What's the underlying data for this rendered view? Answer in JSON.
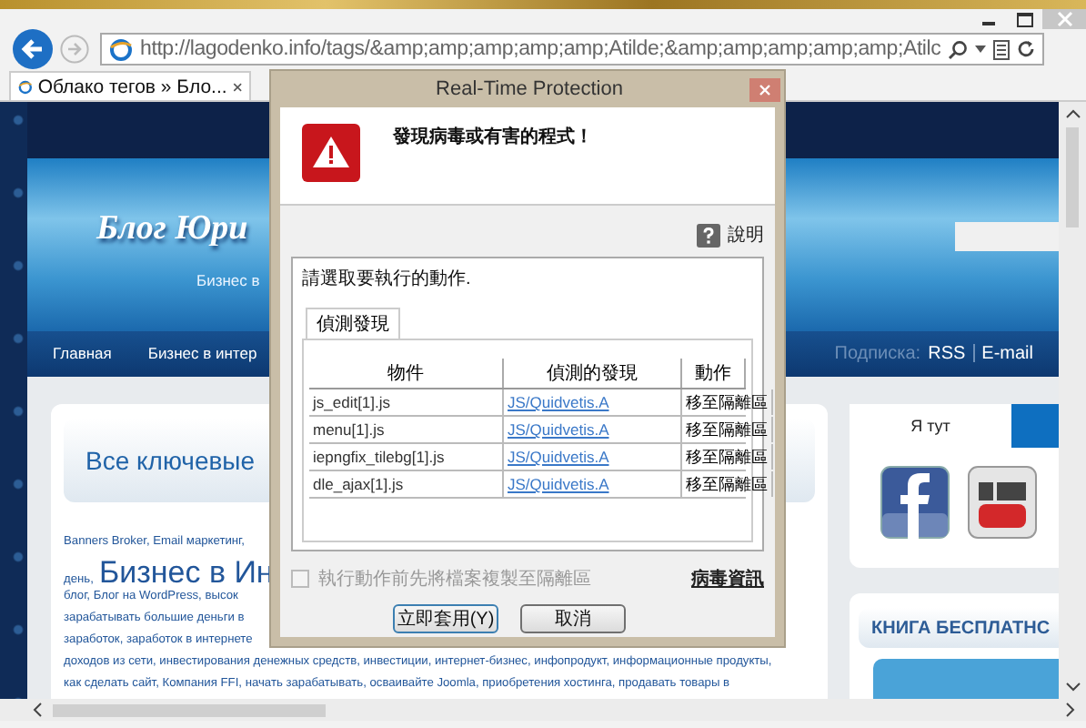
{
  "browser": {
    "address": "http://lagodenko.info/tags/&amp;amp;amp;amp;amp;Atilde;&amp;amp;amp;amp;amp;Atilc",
    "tab": {
      "title": "Облако тегов » Бло...",
      "selected": true
    }
  },
  "page": {
    "site_title": "Блог Юри",
    "tagline": "Бизнес в",
    "nav": [
      "Главная",
      "Бизнес в интер"
    ],
    "subscribe": {
      "label": "Подписка:",
      "links": [
        "RSS",
        "E-mail"
      ]
    },
    "heading": "Все ключевые",
    "tag_lines": [
      {
        "parts": [
          {
            "text": "Banners Broker, Email маркетинг,",
            "kind": "small"
          }
        ]
      },
      {
        "parts": [
          {
            "text": "день,",
            "kind": "small"
          },
          {
            "text": "Бизнес в Ин",
            "kind": "large"
          }
        ]
      },
      {
        "parts": [
          {
            "text": "блог, Блог на WordPress, высок",
            "kind": "small"
          }
        ]
      },
      {
        "parts": [
          {
            "text": "зарабатывать большие деньги в",
            "kind": "small"
          }
        ]
      },
      {
        "parts": [
          {
            "text": "заработок, заработок в интернете",
            "kind": "small"
          }
        ]
      },
      {
        "parts": [
          {
            "text": "доходов из сети, инвестирования денежных средств, инвестиции, интернет-бизнес, инфопродукт, информационные продукты,",
            "kind": "small"
          }
        ]
      },
      {
        "parts": [
          {
            "text": "как сделать сайт, Компания FFI, начать зарабатывать, осваивайте Joomla, приобретения хостинга, продавать товары в",
            "kind": "small"
          }
        ]
      }
    ],
    "sidebar": {
      "tabs": [
        {
          "label": "Я тут",
          "selected": true
        }
      ],
      "book_title": "КНИГА БЕСПЛАТНС"
    }
  },
  "dialog": {
    "title": "Real-Time Protection",
    "message": "發現病毒或有害的程式！",
    "help": "說明",
    "instruction": "請選取要執行的動作.",
    "tab": {
      "label": "偵測發現",
      "selected": true
    },
    "columns": [
      "物件",
      "偵測的發現",
      "動作"
    ],
    "rows": [
      {
        "object": "js_edit[1].js",
        "detection": "JS/Quidvetis.A",
        "action": "移至隔離區"
      },
      {
        "object": "menu[1].js",
        "detection": "JS/Quidvetis.A",
        "action": "移至隔離區"
      },
      {
        "object": "iepngfix_tilebg[1].js",
        "detection": "JS/Quidvetis.A",
        "action": "移至隔離區"
      },
      {
        "object": "dle_ajax[1].js",
        "detection": "JS/Quidvetis.A",
        "action": "移至隔離區"
      }
    ],
    "copy_option": {
      "label": "執行動作前先將檔案複製至隔離區",
      "checked": false,
      "disabled": true
    },
    "info_link": "病毒資訊",
    "buttons": [
      "立即套用(Y)",
      "取消"
    ]
  }
}
